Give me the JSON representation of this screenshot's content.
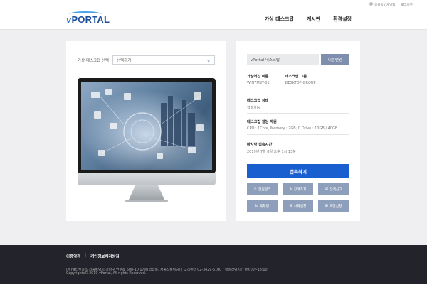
{
  "topbar": {
    "user": "홍길동 / 개발팀",
    "logout": "로그아웃"
  },
  "header": {
    "logo_v": "v",
    "logo_text": "PORTAL",
    "nav": [
      "가상 데스크탑",
      "게시판",
      "환경설정"
    ]
  },
  "left": {
    "vd_label": "가상 데스크탑 선택",
    "select_value": "선택하기"
  },
  "right": {
    "name_value": "vPortal 데스크탑",
    "name_button": "이름변경",
    "vm_name_label": "가상머신 이름",
    "vm_name_value": "WIN7MST-01",
    "group_label": "데스크탑 그룹",
    "group_value": "DESKTOP-GROUP",
    "state_label": "데스크탑 상태",
    "state_value": "접속가능",
    "res_label": "데스크탑 할당 자원",
    "res_value": "CPU : 1Core, Memory : 2GB, C Drive : 10GB / 40GB",
    "last_label": "마지막 접속시간",
    "last_value": "2019년 7월 8일 오후 1시 13분",
    "connect": "접속하기",
    "actions": [
      {
        "icon": "☼",
        "label": "전원관리"
      },
      {
        "icon": "⊞",
        "label": "장애조치"
      },
      {
        "icon": "▤",
        "label": "장애신고"
      },
      {
        "icon": "⊟",
        "label": "재부팅"
      },
      {
        "icon": "⊠",
        "label": "삭제신청"
      },
      {
        "icon": "⊞",
        "label": "포맷신청"
      }
    ]
  },
  "footer": {
    "terms": "이용약관",
    "divider": "|",
    "privacy": "개인정보처리방침",
    "address": "(주)웹티켓하스 서울특별시 강남구 언주로 508-10 17층(역삼동, 서울상록빌딩) | 고객센터 02-3429-5100 | 평일상담시간 09:00~18:00",
    "copyright": "Copyrights© 2019 vPortal, All rights Reserved."
  }
}
